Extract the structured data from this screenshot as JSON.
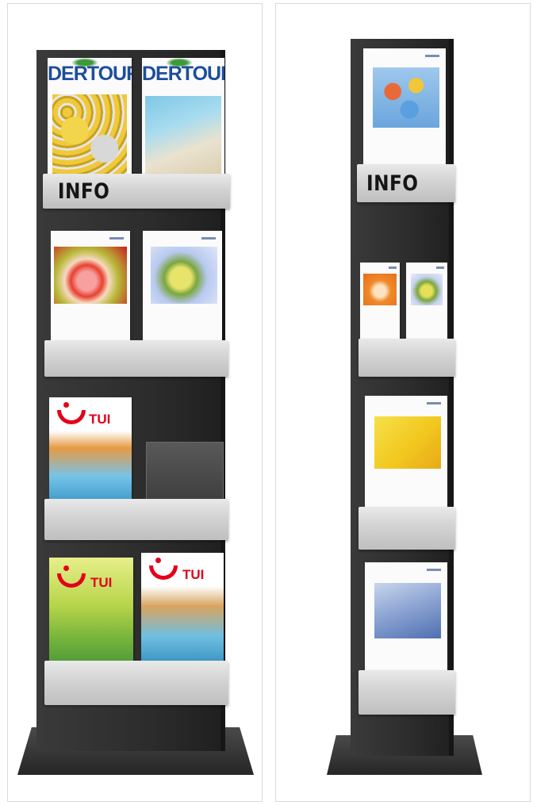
{
  "stands": {
    "left": {
      "sign": "INFO",
      "dertour_logo": "DERTOUR",
      "tui_logo": "TUI"
    },
    "right": {
      "sign": "INFO"
    }
  },
  "colors": {
    "stand": "#2c2c2c",
    "tray": "#d3d3d3",
    "dertour_blue": "#1d4e9c",
    "tui_red": "#e3001b"
  }
}
